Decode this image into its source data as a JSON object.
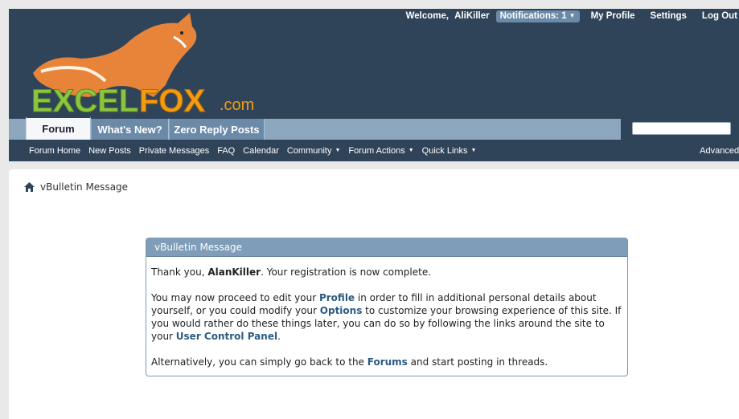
{
  "toplinks": {
    "welcome": "Welcome,",
    "username": "AliKiller",
    "notifications": "Notifications: 1",
    "my_profile": "My Profile",
    "settings": "Settings",
    "logout": "Log Out"
  },
  "logo": {
    "text_excel": "EXCEL",
    "text_fox": "FOX",
    "text_com": ".com"
  },
  "tabs": [
    {
      "label": "Forum",
      "active": true
    },
    {
      "label": "What's New?"
    },
    {
      "label": "Zero Reply Posts"
    }
  ],
  "search": {
    "placeholder": ""
  },
  "subnav": {
    "items": [
      "Forum Home",
      "New Posts",
      "Private Messages",
      "FAQ",
      "Calendar"
    ],
    "dropdowns": [
      "Community",
      "Forum Actions",
      "Quick Links"
    ],
    "advanced_search": "Advanced Search"
  },
  "breadcrumb": {
    "label": "vBulletin Message"
  },
  "message": {
    "title": "vBulletin Message",
    "p1_before": "Thank you, ",
    "p1_name": "AlanKiller",
    "p1_after": ". Your registration is now complete.",
    "p2_a": "You may now proceed to edit your ",
    "p2_profile": "Profile",
    "p2_b": " in order to fill in additional personal details about yourself, or you could modify your ",
    "p2_options": "Options",
    "p2_c": " to customize your browsing experience of this site. If you would rather do these things later, you can do so by following the links around the site to your ",
    "p2_ucp": "User Control Panel",
    "p2_d": ".",
    "p3_a": "Alternatively, you can simply go back to the ",
    "p3_forums": "Forums",
    "p3_b": " and start posting in threads."
  },
  "colors": {
    "header_bg": "#304459",
    "tab_bar": "#8da7bf",
    "link": "#2b5b84",
    "box_head": "#7f9cb8"
  },
  "icons": {
    "home": "home-icon",
    "caret": "caret-down-icon"
  }
}
